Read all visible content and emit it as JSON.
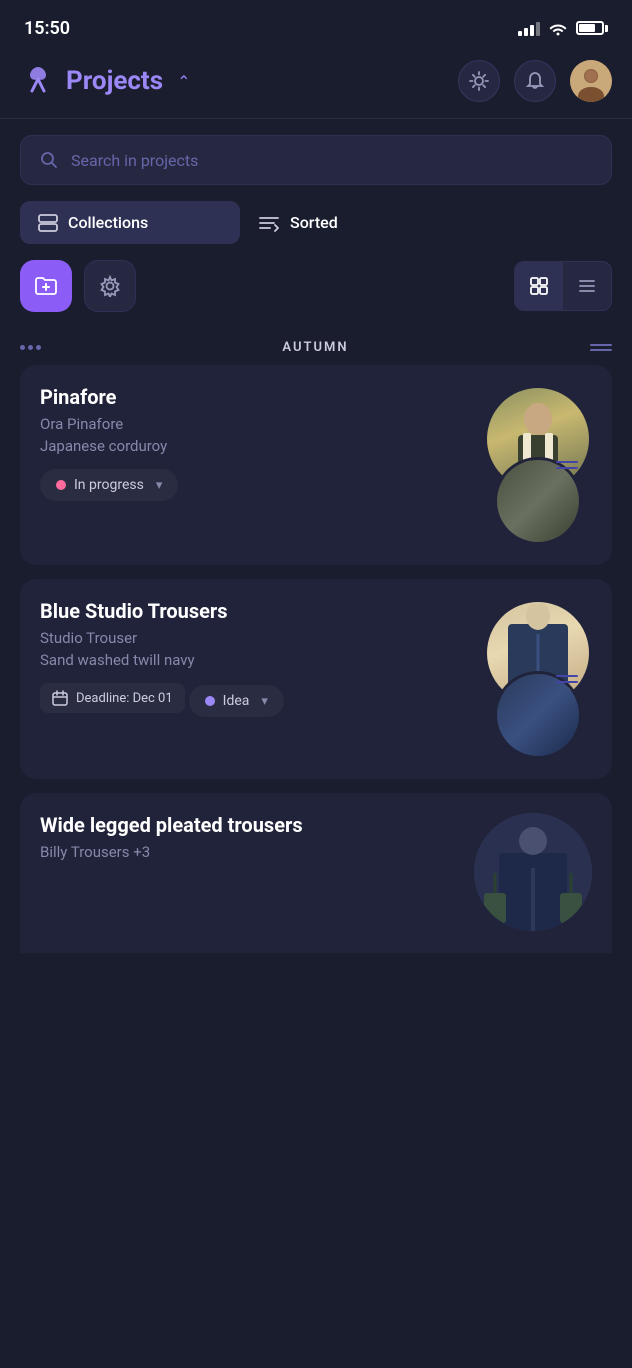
{
  "statusBar": {
    "time": "15:50"
  },
  "header": {
    "title": "Projects",
    "logoAlt": "Tilda logo"
  },
  "search": {
    "placeholder": "Search in projects"
  },
  "filters": {
    "collections": "Collections",
    "sorted": "Sorted"
  },
  "actions": {
    "addBtn": "+",
    "settingsBtn": "⚙",
    "viewGrid": "grid",
    "viewList": "list"
  },
  "section": {
    "title": "AUTUMN"
  },
  "projects": [
    {
      "id": 1,
      "title": "Pinafore",
      "subtitle": "Ora Pinafore",
      "material": "Japanese corduroy",
      "deadline": null,
      "status": "In progress",
      "statusColor": "pink",
      "statusDot": "pink"
    },
    {
      "id": 2,
      "title": "Blue Studio Trousers",
      "subtitle": "Studio Trouser",
      "material": "Sand washed twill navy",
      "deadline": "Deadline: Dec 01",
      "status": "Idea",
      "statusColor": "purple",
      "statusDot": "purple"
    },
    {
      "id": 3,
      "title": "Wide legged pleated trousers",
      "subtitle": "Billy Trousers +3",
      "material": null,
      "deadline": null,
      "status": null,
      "statusColor": null,
      "statusDot": null
    }
  ]
}
